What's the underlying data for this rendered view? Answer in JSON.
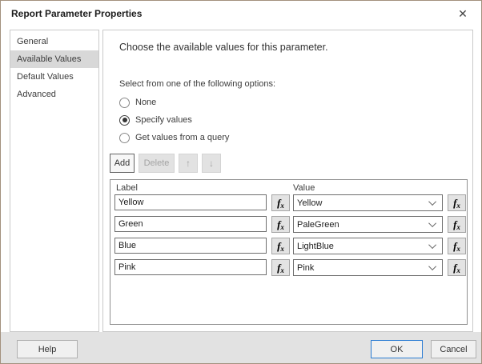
{
  "dialog": {
    "title": "Report Parameter Properties",
    "close_icon": "✕"
  },
  "sidebar": {
    "items": [
      {
        "label": "General",
        "selected": false
      },
      {
        "label": "Available Values",
        "selected": true
      },
      {
        "label": "Default Values",
        "selected": false
      },
      {
        "label": "Advanced",
        "selected": false
      }
    ]
  },
  "main": {
    "heading": "Choose the available values for this parameter.",
    "options_label": "Select from one of the following options:",
    "radios": [
      {
        "label": "None",
        "selected": false
      },
      {
        "label": "Specify values",
        "selected": true
      },
      {
        "label": "Get values from a query",
        "selected": false
      }
    ],
    "toolbar": {
      "add_label": "Add",
      "delete_label": "Delete",
      "up_icon": "↑",
      "down_icon": "↓"
    },
    "table": {
      "columns": [
        "Label",
        "Value"
      ],
      "fx_icon_f": "f",
      "fx_icon_x": "x",
      "rows": [
        {
          "label": "Yellow",
          "value": "Yellow"
        },
        {
          "label": "Green",
          "value": "PaleGreen"
        },
        {
          "label": "Blue",
          "value": "LightBlue"
        },
        {
          "label": "Pink",
          "value": "Pink"
        }
      ]
    }
  },
  "footer": {
    "help_label": "Help",
    "ok_label": "OK",
    "cancel_label": "Cancel"
  },
  "colors": {
    "accent_ok_border": "#2b7cd3",
    "selected_item_bg": "#d8d8d8",
    "dialog_border": "#a3917e"
  }
}
